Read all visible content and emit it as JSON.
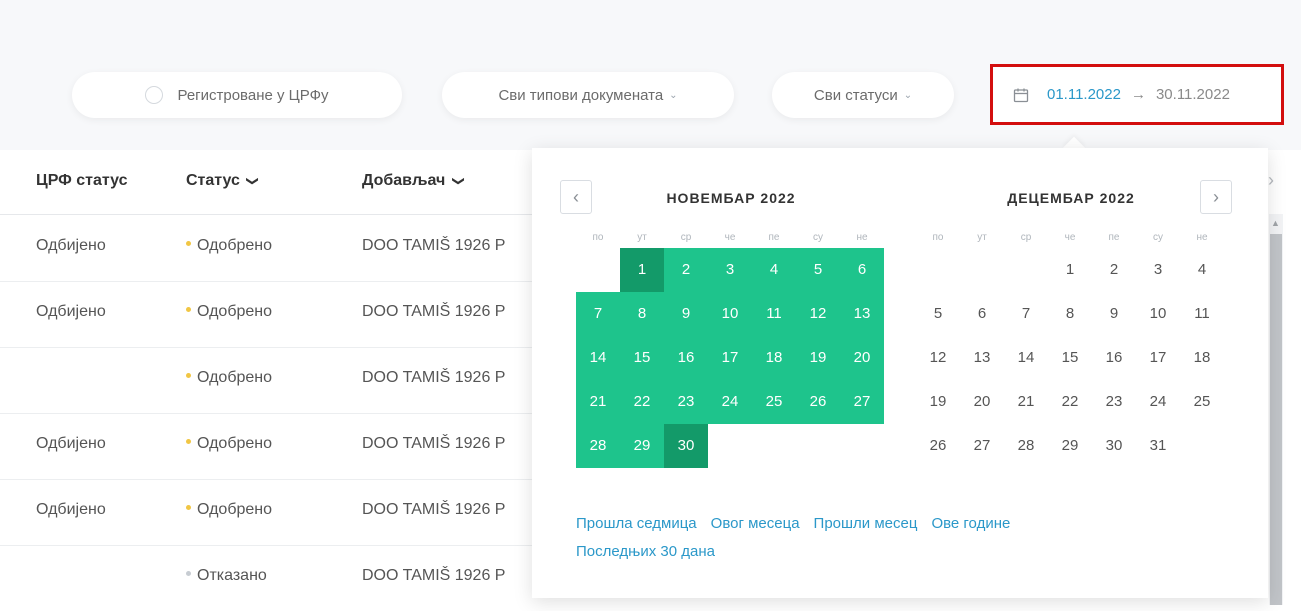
{
  "filters": {
    "registered_label": "Регистроване у ЦРФу",
    "doc_types_label": "Сви типови докумената",
    "statuses_label": "Сви статуси"
  },
  "date_range": {
    "start": "01.11.2022",
    "arrow": "→",
    "end": "30.11.2022"
  },
  "table": {
    "headers": {
      "crf_status": "ЦРФ статус",
      "status": "Статус",
      "supplier": "Добављач"
    },
    "rows": [
      {
        "crf_status": "Одбијено",
        "status": "Одобрено",
        "supplier": "DOO TAMIŠ 1926 P"
      },
      {
        "crf_status": "Одбијено",
        "status": "Одобрено",
        "supplier": "DOO TAMIŠ 1926 P"
      },
      {
        "crf_status": "",
        "status": "Одобрено",
        "supplier": "DOO TAMIŠ 1926 P"
      },
      {
        "crf_status": "Одбијено",
        "status": "Одобрено",
        "supplier": "DOO TAMIŠ 1926 P"
      },
      {
        "crf_status": "Одбијено",
        "status": "Одобрено",
        "supplier": "DOO TAMIŠ 1926 P"
      },
      {
        "crf_status": "",
        "status": "Отказано",
        "supplier": "DOO TAMIŠ 1926 P"
      }
    ]
  },
  "calendar": {
    "weekdays": [
      "по",
      "ут",
      "ср",
      "че",
      "пе",
      "су",
      "не"
    ],
    "months": [
      {
        "title": "НОВЕМБАР 2022",
        "first_weekday": 1,
        "days": 30
      },
      {
        "title": "ДЕЦЕМБАР 2022",
        "first_weekday": 3,
        "days": 31
      }
    ],
    "selected_start_day": 1,
    "selected_end_day": 30,
    "presets": [
      "Прошла седмица",
      "Овог месеца",
      "Прошли месец",
      "Ове године",
      "Последњих 30 дана"
    ]
  },
  "colors": {
    "range_fill": "#1ec48c",
    "range_edge": "#139a69",
    "link": "#2b98c9",
    "highlight_border": "#d30e0e"
  },
  "icons": {
    "nav_prev": "‹",
    "nav_next": "›",
    "chevron_down": "⌄",
    "header_chevron": "❯"
  }
}
